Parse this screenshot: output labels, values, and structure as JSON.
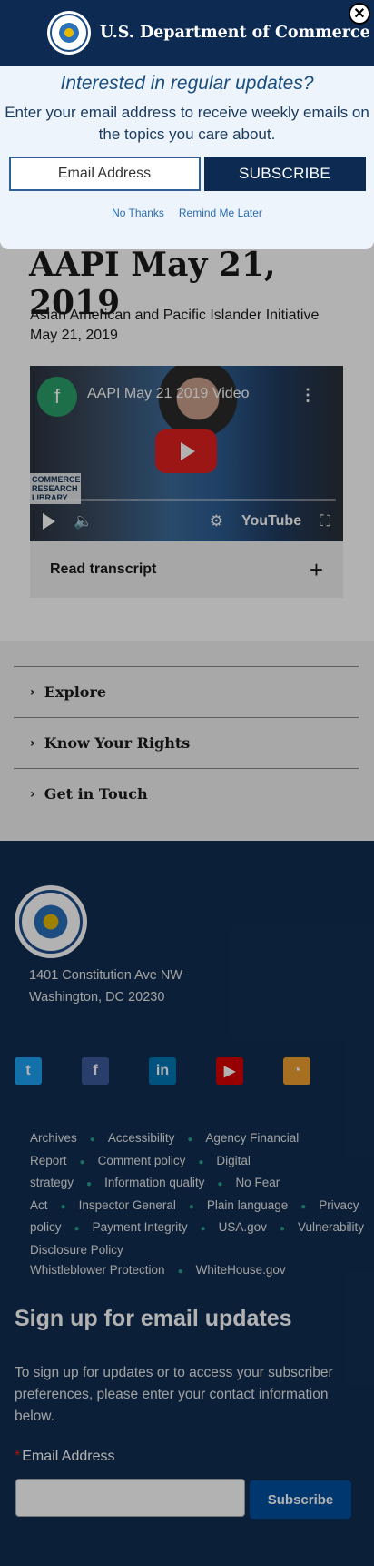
{
  "modal": {
    "header_title": "U.S. Department of Commerce",
    "close_symbol": "✕",
    "headline": "Interested in regular updates?",
    "description": "Enter your email address to receive weekly emails on the topics you care about.",
    "email_placeholder": "Email Address",
    "subscribe_label": "SUBSCRIBE",
    "no_thanks_label": "No Thanks",
    "remind_later_label": "Remind Me Later"
  },
  "content": {
    "title": "AAPI May 21, 2019",
    "subtitle_line1": "Asian American and Pacific Islander Initiative",
    "subtitle_line2": "May 21, 2019",
    "video": {
      "channel_letter": "f",
      "title": "AAPI May 21 2019 Video",
      "overlay_label": "COMMERCE RESEARCH LIBRARY",
      "youtube_label": "YouTube"
    },
    "transcript_label": "Read transcript",
    "transcript_icon": "+"
  },
  "nav_accordion": {
    "items": [
      {
        "label": "Explore"
      },
      {
        "label": "Know Your Rights"
      },
      {
        "label": "Get in Touch"
      }
    ]
  },
  "footer": {
    "address_line1": "1401 Constitution Ave NW",
    "address_line2": "Washington, DC 20230",
    "social": [
      {
        "icon": "twitter-icon",
        "glyph": "t"
      },
      {
        "icon": "facebook-icon",
        "glyph": "f"
      },
      {
        "icon": "linkedin-icon",
        "glyph": "in"
      },
      {
        "icon": "youtube-icon",
        "glyph": "▶"
      },
      {
        "icon": "rss-icon",
        "glyph": "◔"
      }
    ],
    "links": [
      "Archives",
      "Accessibility",
      "Agency Financial Report",
      "Comment policy",
      "Digital strategy",
      "Information quality",
      "No Fear Act",
      "Inspector General",
      "Plain language",
      "Privacy policy",
      "Payment Integrity",
      "USA.gov",
      "Vulnerability Disclosure Policy",
      "Whistleblower Protection",
      "WhiteHouse.gov"
    ],
    "signup_heading": "Sign up for email updates",
    "signup_text": "To sign up for updates or to access your subscriber preferences, please enter your contact information below.",
    "email_label": "Email Address",
    "required_mark": "*",
    "subscribe_button": "Subscribe"
  }
}
